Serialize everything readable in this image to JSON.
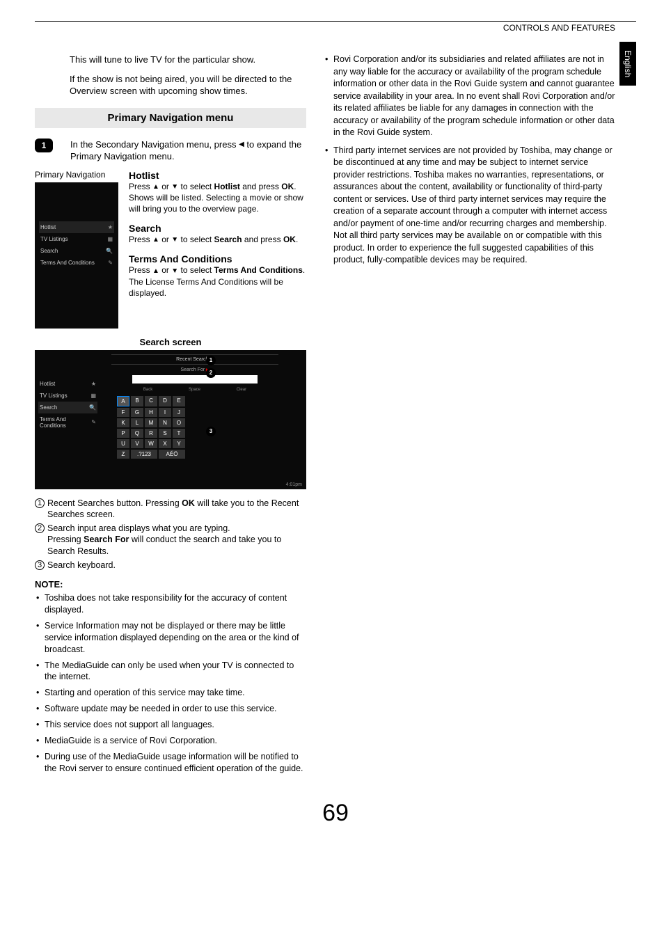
{
  "header": {
    "section": "CONTROLS AND FEATURES",
    "language_tab": "English"
  },
  "intro": {
    "p1": "This will tune to live TV for the particular show.",
    "p2": "If the show is not being aired, you will be directed to the Overview screen with upcoming show times."
  },
  "heading_primary_nav": "Primary Navigation menu",
  "step1": {
    "num": "1",
    "text_a": "In the Secondary Navigation menu, press ",
    "text_b": " to expand the Primary Navigation menu."
  },
  "nav_caption": "Primary Navigation",
  "nav_items": {
    "hotlist": "Hotlist",
    "tv": "TV Listings",
    "search": "Search",
    "terms": "Terms And Conditions"
  },
  "desc": {
    "hotlist": {
      "title": "Hotlist",
      "a": "Press ",
      "b": " or ",
      "c": " to select ",
      "bold": "Hotlist",
      "d": " and press ",
      "ok": "OK",
      "e": ". Shows will be listed. Selecting a movie or show will bring you to the overview page."
    },
    "search": {
      "title": "Search",
      "a": "Press ",
      "b": " or ",
      "c": " to select ",
      "bold": "Search",
      "d": " and press ",
      "ok": "OK",
      "e": "."
    },
    "terms": {
      "title": "Terms And Conditions",
      "a": "Press ",
      "b": " or ",
      "c": " to select ",
      "bold": "Terms And Conditions",
      "d": ".",
      "e": "The License Terms And Conditions will be displayed."
    }
  },
  "search_screen": {
    "caption": "Search screen",
    "recent": "Recent Searches",
    "search_for": "Search For",
    "back": "Back",
    "space": "Space",
    "clear": "Clear",
    "keys": [
      "A",
      "B",
      "C",
      "D",
      "E",
      "F",
      "G",
      "H",
      "I",
      "J",
      "K",
      "L",
      "M",
      "N",
      "O",
      "P",
      "Q",
      "R",
      "S",
      "T",
      "U",
      "V",
      "W",
      "X",
      "Y",
      "Z",
      ".?123",
      "AÉÖ"
    ],
    "time": "4:01pm"
  },
  "callouts": {
    "c1": "1",
    "c2": "2",
    "c3": "3"
  },
  "search_list": {
    "i1a": "Recent Searches button. Pressing ",
    "i1ok": "OK",
    "i1b": " will take you to the Recent Searches screen.",
    "i2a": "Search input area displays what you are typing.",
    "i2b": "Pressing ",
    "i2bold": "Search For",
    "i2c": " will conduct the search and take you to Search Results.",
    "i3": "Search keyboard."
  },
  "note": {
    "head": "NOTE:",
    "items": [
      "Toshiba does not take responsibility for the accuracy of content displayed.",
      "Service Information may not be displayed or there may be little service information displayed depending on the area or the kind of broadcast.",
      "The MediaGuide can only be used when your TV is connected to the internet.",
      "Starting and operation of this service may take time.",
      "Software update may be needed in order to use this service.",
      "This service does not support all languages.",
      "MediaGuide is a service of Rovi Corporation.",
      "During use of the MediaGuide usage information will be notified to the Rovi server to ensure continued efficient operation of the guide."
    ]
  },
  "right_col": {
    "items": [
      "Rovi Corporation and/or its subsidiaries and related affiliates are not in any way liable for the accuracy or availability of the program schedule information or other data in the Rovi Guide system and cannot guarantee service availability in your area. In no event shall Rovi Corporation and/or its related affiliates be liable for any damages in connection with the accuracy or availability of the program schedule information or other data in the Rovi Guide system.",
      "Third party internet services are not provided by Toshiba, may change or be discontinued at any time and may be subject to internet service provider restrictions. Toshiba makes no warranties, representations, or assurances about the content, availability or functionality of third-party content or services. Use of third party internet services may require the creation of a separate account through a computer with internet access and/or payment of one-time and/or recurring charges and membership. Not all third party services may be available on or compatible with this product. In order to experience the full suggested capabilities of this product, fully-compatible devices may be required."
    ]
  },
  "page_number": "69"
}
